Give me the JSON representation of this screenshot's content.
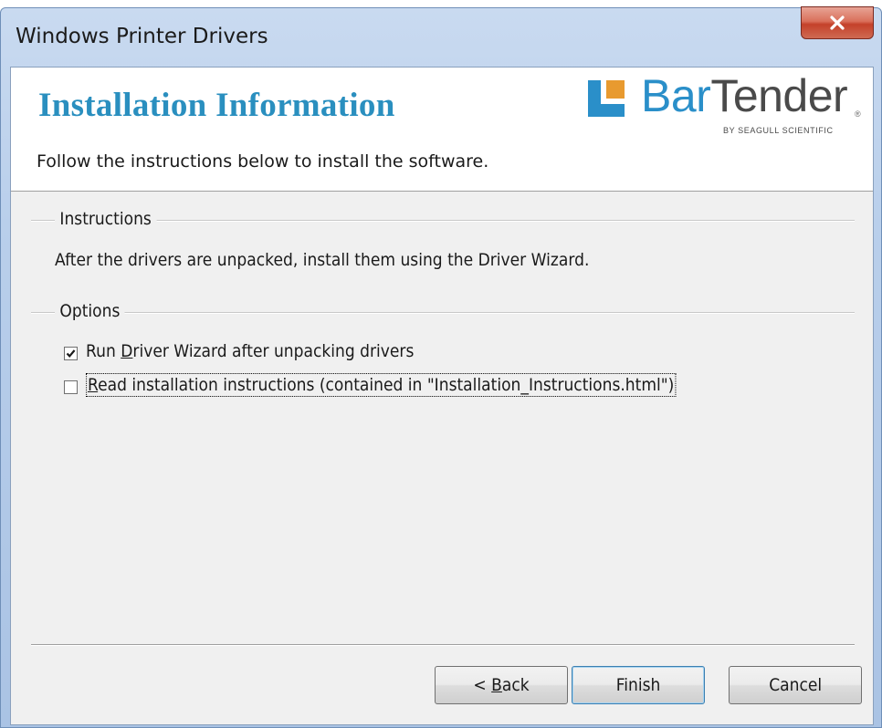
{
  "window": {
    "title": "Windows Printer Drivers"
  },
  "header": {
    "title": "Installation Information",
    "subtitle": "Follow the instructions below to install the software.",
    "logo": {
      "brand_part1": "Bar",
      "brand_part2": "Tender",
      "registered": "®",
      "byline": "BY SEAGULL SCIENTIFIC"
    }
  },
  "instructions": {
    "group_label": "Instructions",
    "text": "After the drivers are unpacked, install them using the Driver Wizard."
  },
  "options": {
    "group_label": "Options",
    "items": [
      {
        "prefix": "Run ",
        "mnemonic": "D",
        "suffix": "river Wizard after unpacking drivers",
        "checked": true
      },
      {
        "prefix": "",
        "mnemonic": "R",
        "suffix": "ead installation instructions (contained in \"Installation_Instructions.html\")",
        "checked": false
      }
    ]
  },
  "buttons": {
    "back_prefix": "< ",
    "back_mnemonic": "B",
    "back_suffix": "ack",
    "finish": "Finish",
    "cancel": "Cancel"
  },
  "colors": {
    "title_blue": "#2a8fbf",
    "logo_blue": "#2a8fc9",
    "logo_gray": "#4a4a4a",
    "close_red": "#c4412a"
  },
  "icons": {
    "close": "close-icon",
    "logo_mark": "bartender-logo-mark-icon",
    "checkmark": "checkmark-icon"
  }
}
